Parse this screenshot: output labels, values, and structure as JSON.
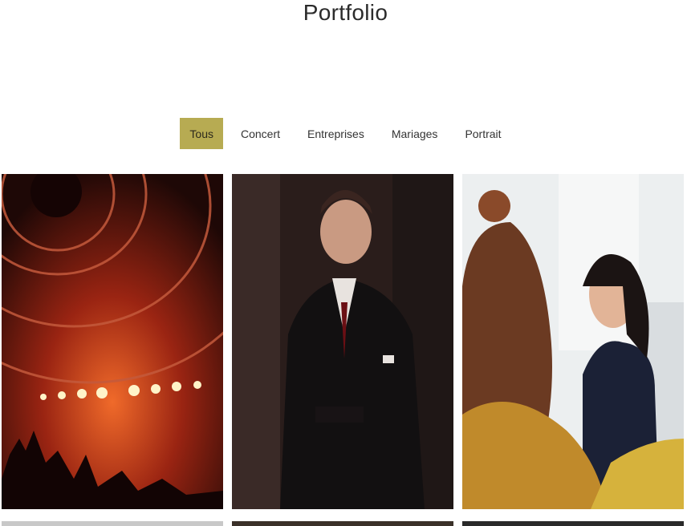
{
  "page": {
    "title": "Portfolio"
  },
  "filters": [
    {
      "label": "Tous",
      "active": true
    },
    {
      "label": "Concert",
      "active": false
    },
    {
      "label": "Entreprises",
      "active": false
    },
    {
      "label": "Mariages",
      "active": false
    },
    {
      "label": "Portrait",
      "active": false
    }
  ],
  "colors": {
    "accent": "#b7ab52",
    "text": "#2b2b2b",
    "background": "#ffffff"
  },
  "gallery": [
    {
      "subject": "concert-stage-lights"
    },
    {
      "subject": "man-in-suit-portrait"
    },
    {
      "subject": "business-meeting-smiling-woman"
    }
  ]
}
